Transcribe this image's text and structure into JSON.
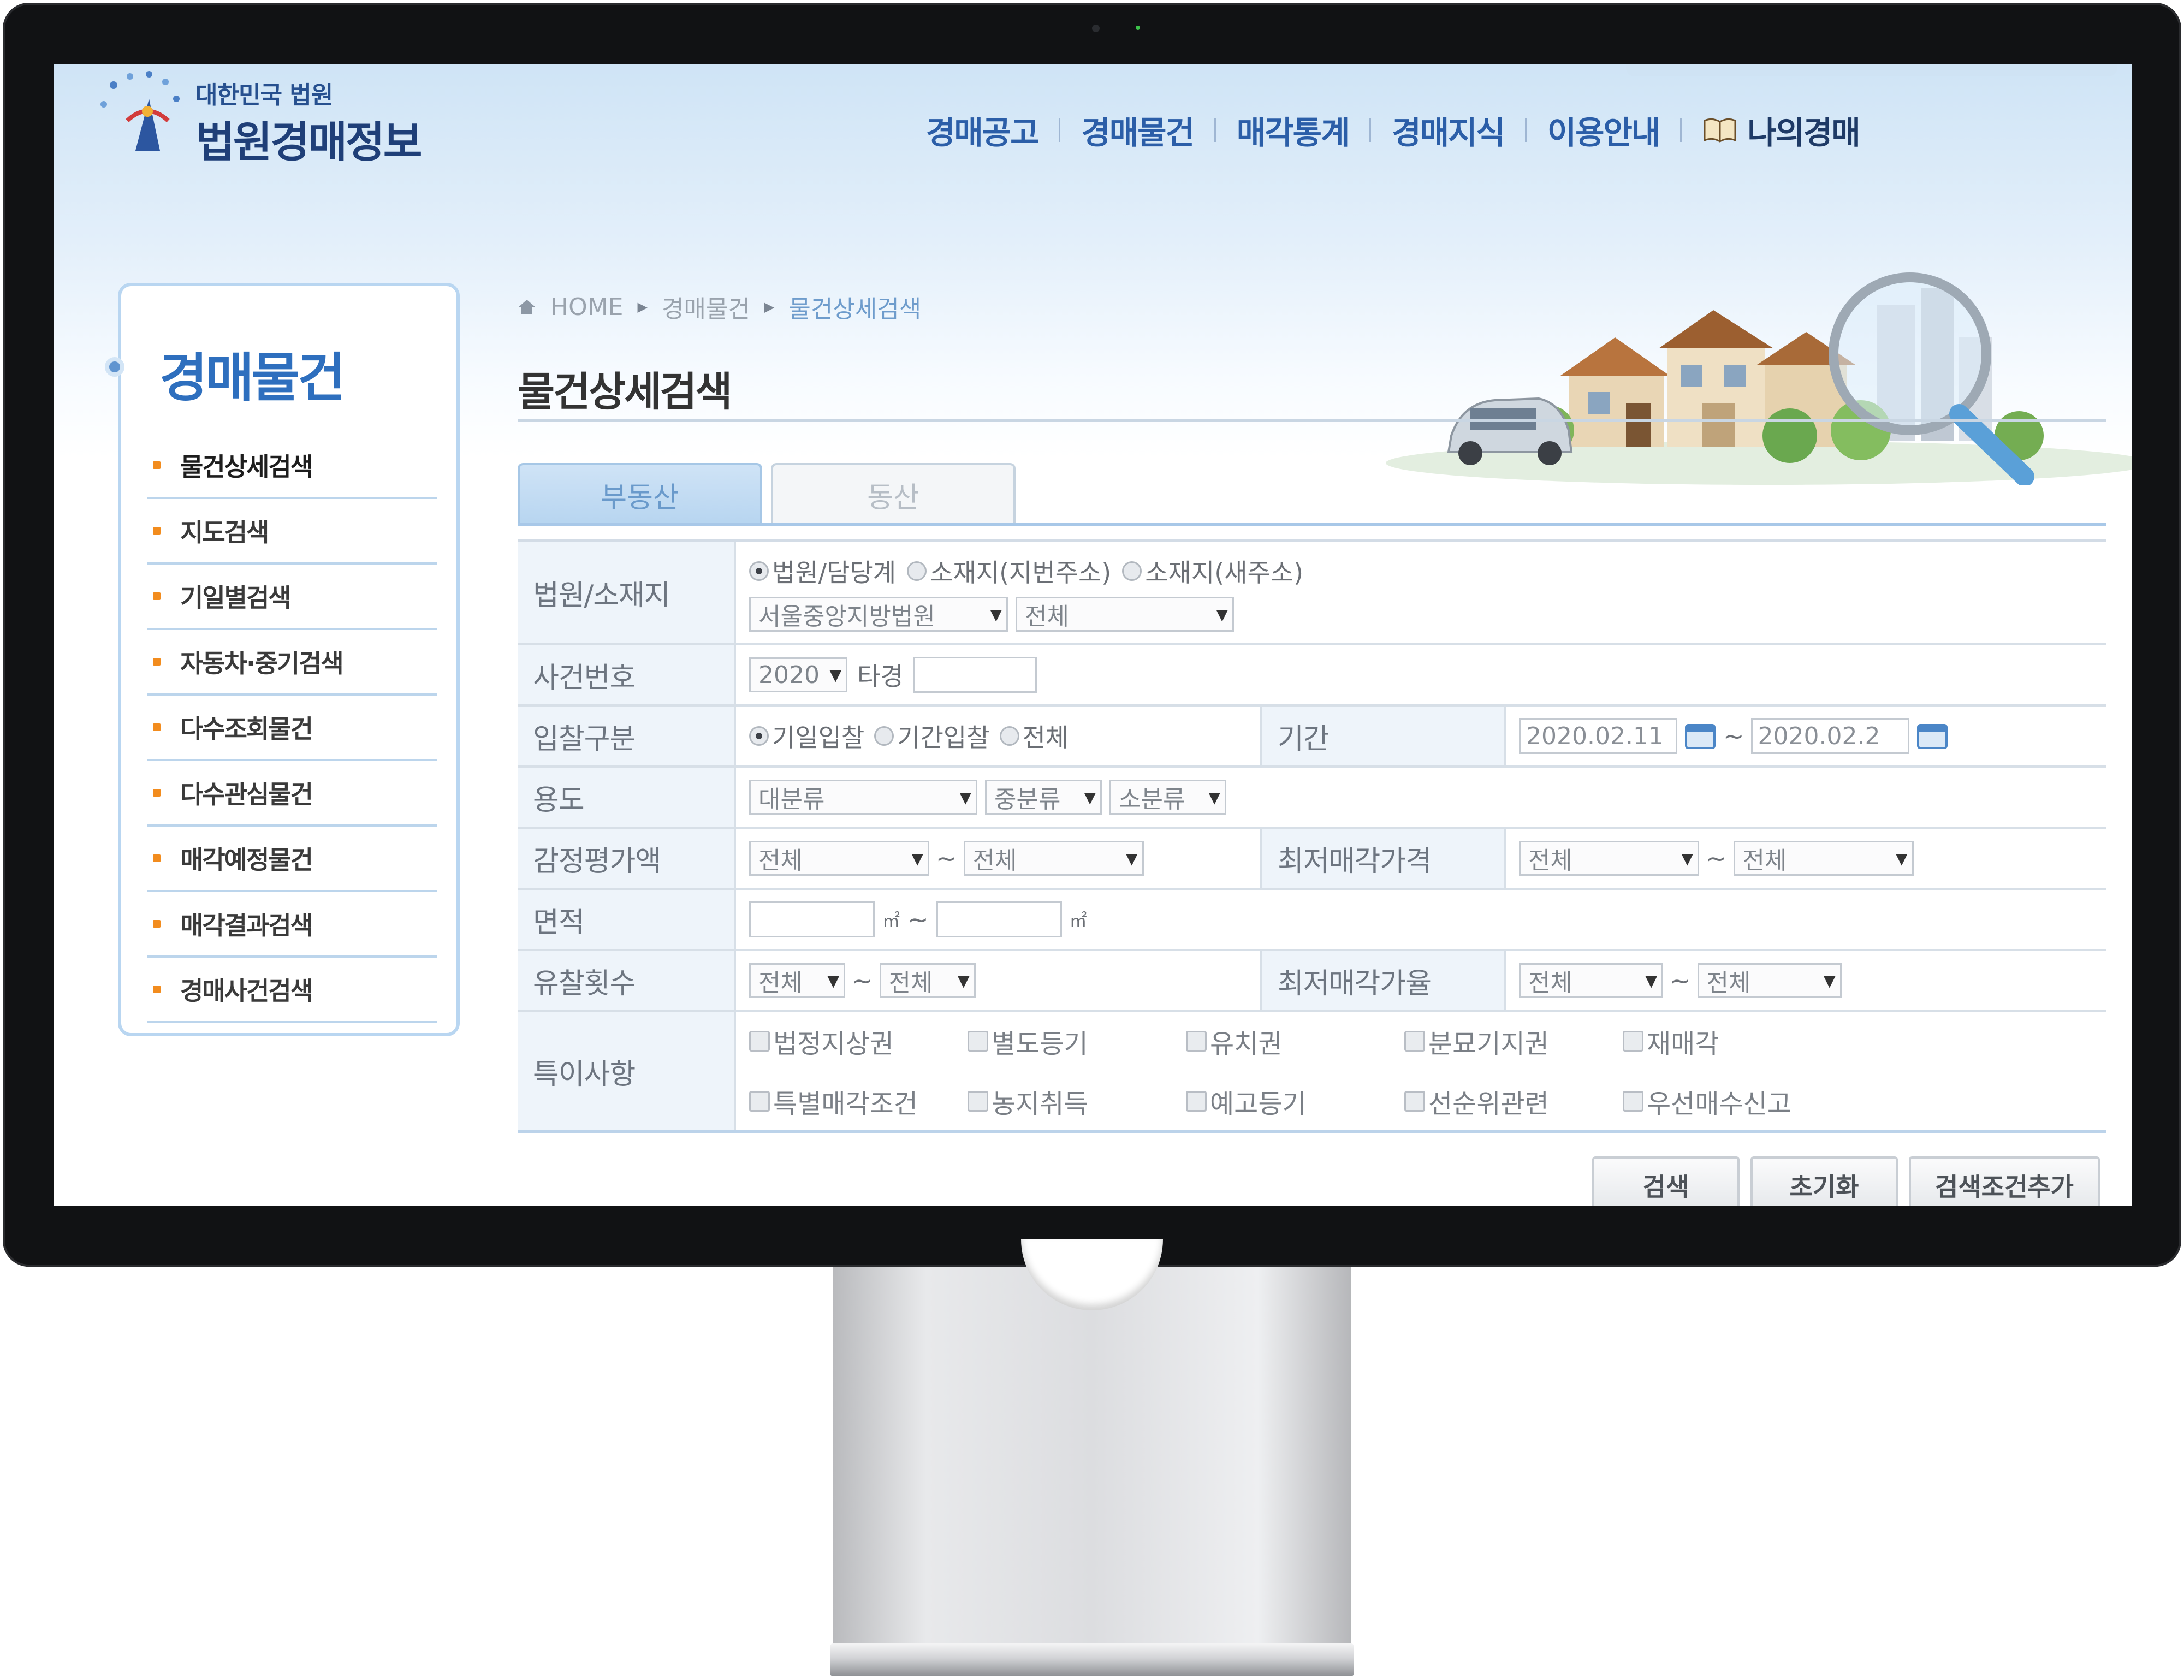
{
  "site": {
    "logo_sub": "대한민국 법원",
    "logo_main": "법원경매정보"
  },
  "gnb": {
    "items": [
      "경매공고",
      "경매물건",
      "매각통계",
      "경매지식",
      "이용안내"
    ],
    "mine": "나의경매"
  },
  "sidebar": {
    "title": "경매물건",
    "items": [
      "물건상세검색",
      "지도검색",
      "기일별검색",
      "자동차·중기검색",
      "다수조회물건",
      "다수관심물건",
      "매각예정물건",
      "매각결과검색",
      "경매사건검색"
    ]
  },
  "breadcrumb": [
    "HOME",
    "경매물건",
    "물건상세검색"
  ],
  "page_title": "물건상세검색",
  "tabs": [
    "부동산",
    "동산"
  ],
  "form": {
    "court": {
      "label": "법원/소재지",
      "options": [
        "법원/담당계",
        "소재지(지번주소)",
        "소재지(새주소)"
      ],
      "court_select": "서울중앙지방법원",
      "dept_select": "전체"
    },
    "case": {
      "label": "사건번호",
      "year": "2020",
      "suffix": "타경"
    },
    "bid": {
      "label": "입찰구분",
      "options": [
        "기일입찰",
        "기간입찰",
        "전체"
      ],
      "period_label": "기간",
      "from": "2020.02.11",
      "to": "2020.02.2",
      "tilde": "~"
    },
    "use": {
      "label": "용도",
      "large": "대분류",
      "medium": "중분류",
      "small": "소분류"
    },
    "appraisal": {
      "label": "감정평가액",
      "from": "전체",
      "to": "전체",
      "min_label": "최저매각가격",
      "min_from": "전체",
      "min_to": "전체",
      "dash": "~"
    },
    "area": {
      "label": "면적",
      "unit": "㎡",
      "tilde": "~"
    },
    "failed": {
      "label": "유찰횟수",
      "from": "전체",
      "to": "전체",
      "rate_label": "최저매각가율",
      "rate_from": "전체",
      "rate_to": "전체",
      "dash": "~"
    },
    "special": {
      "label": "특이사항",
      "items": [
        "법정지상권",
        "별도등기",
        "유치권",
        "분묘기지권",
        "재매각",
        "특별매각조건",
        "농지취득",
        "예고등기",
        "선순위관련",
        "우선매수신고"
      ]
    }
  },
  "buttons": {
    "search": "검색",
    "reset": "초기화",
    "add_condition": "검색조건추가"
  }
}
